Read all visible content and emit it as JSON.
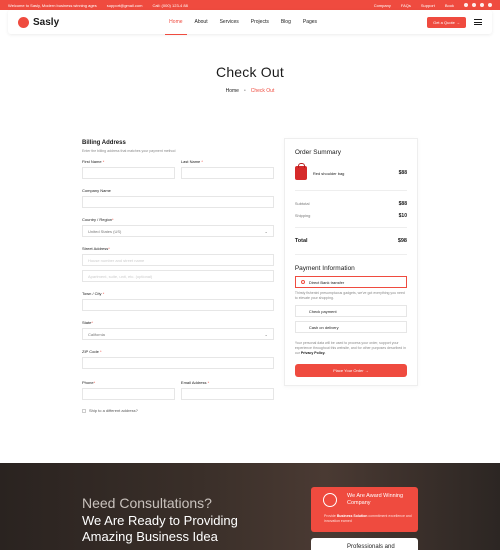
{
  "topbar": {
    "welcome": "Welcome to Sasly, Modern business winning ages",
    "email": "support@gmail.com",
    "phone": "Call: (000) 123-4 88",
    "links": [
      "Company",
      "FAQs",
      "Support",
      "Book"
    ]
  },
  "nav": {
    "brand": "Sasly",
    "menu": [
      "Home",
      "About",
      "Services",
      "Projects",
      "Blog",
      "Pages"
    ],
    "cta": "Get a Quote →"
  },
  "hero": {
    "title": "Check Out",
    "crumb_home": "Home",
    "crumb_current": "Check Out"
  },
  "billing": {
    "title": "Billing Address",
    "subtitle": "Enter the billing address that matches your payment method",
    "first_name": "First Name",
    "last_name": "Last Name",
    "company": "Company Name",
    "country": "Country / Region",
    "country_value": "United States (US)",
    "street": "Street Address",
    "street_ph1": "House number and street name",
    "street_ph2": "Apartment, suite, unit, etc. (optional)",
    "town": "Town / City",
    "state": "State",
    "state_value": "California",
    "zip": "ZIP Code",
    "phone": "Phone",
    "email": "Email Address",
    "ship_diff": "Ship to a different address?"
  },
  "summary": {
    "title": "Order Summary",
    "product": "Red shoulder bag",
    "product_price": "$88",
    "subtotal_label": "Subtotal",
    "subtotal": "$88",
    "shipping_label": "Shipping",
    "shipping": "$10",
    "total_label": "Total",
    "total": "$98"
  },
  "payment": {
    "title": "Payment Information",
    "opt1": "Direct Bank transfer",
    "opt1_desc": "Thirsty fishenini presumptuous gadgets, we've got everything you need to elevate your shopping.",
    "opt2": "Check payment",
    "opt3": "Cash on delivery",
    "policy_pre": "Your personal data will be used to process your order, support your experience throughout this website, and for other purposes described in our ",
    "policy_link": "Privacy Policy.",
    "button": "Place Your Order →"
  },
  "banner": {
    "line1": "Need Consultations?",
    "line2": "We Are Ready to Providing",
    "line3": "Amazing Business Idea",
    "award_title": "We Are Award Winning Company",
    "award_desc_pre": "Provide ",
    "award_desc_bold": "Business Solution",
    "award_desc_post": " commitment excellence and innovation earned",
    "award2": "Professionals and"
  },
  "colors": {
    "accent": "#ef4b3f"
  }
}
